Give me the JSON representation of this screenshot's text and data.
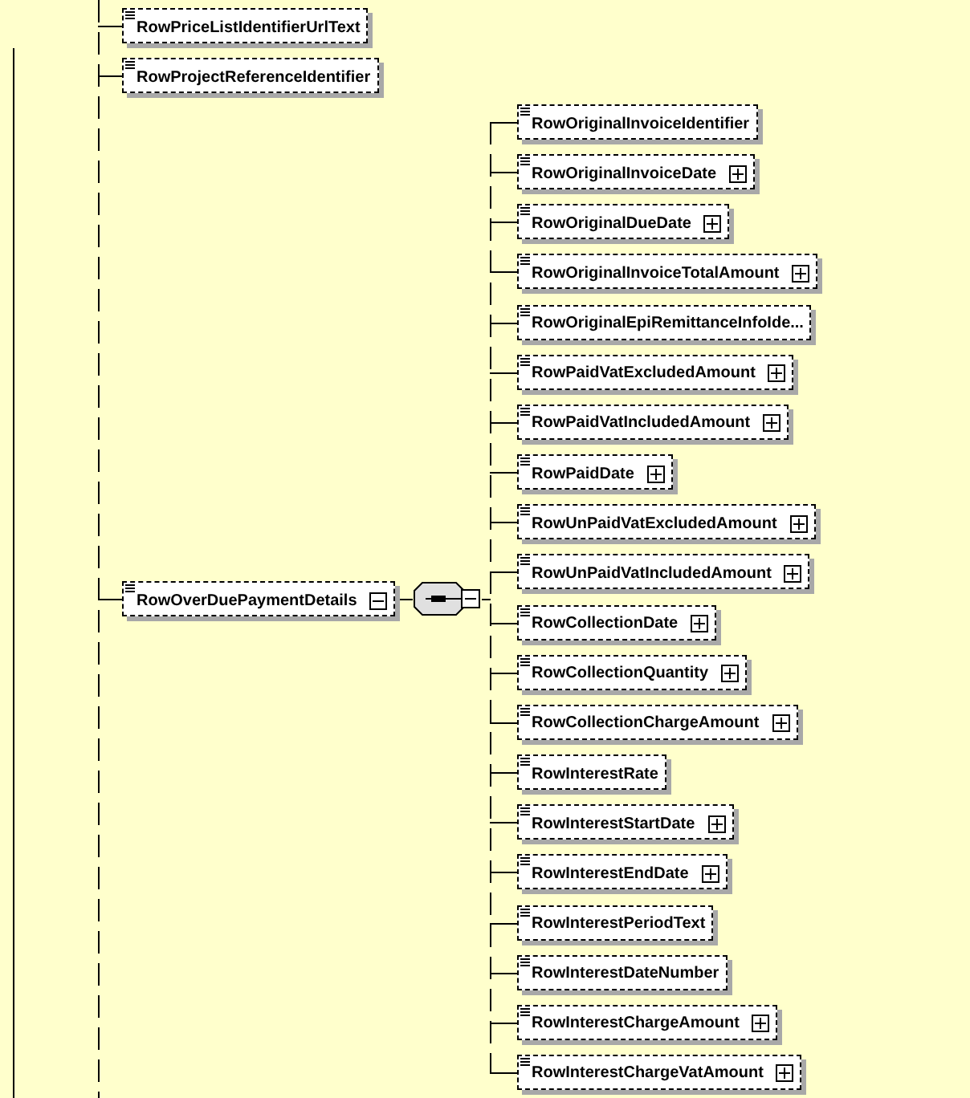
{
  "top_elements": [
    {
      "label": "RowPriceListIdentifierUrlText",
      "optional": true,
      "expandable": false
    },
    {
      "label": "RowProjectReferenceIdentifier",
      "optional": true,
      "expandable": false
    }
  ],
  "element": {
    "label": "RowOverDuePaymentDetails",
    "optional": true,
    "expanded": true
  },
  "sequence": {
    "expanded": true
  },
  "children": [
    {
      "label": "RowOriginalInvoiceIdentifier",
      "optional": true,
      "expandable": false
    },
    {
      "label": "RowOriginalInvoiceDate",
      "optional": true,
      "expandable": true
    },
    {
      "label": "RowOriginalDueDate",
      "optional": true,
      "expandable": true
    },
    {
      "label": "RowOriginalInvoiceTotalAmount",
      "optional": true,
      "expandable": true
    },
    {
      "label": "RowOriginalEpiRemittanceInfoIde...",
      "optional": true,
      "expandable": false
    },
    {
      "label": "RowPaidVatExcludedAmount",
      "optional": true,
      "expandable": true
    },
    {
      "label": "RowPaidVatIncludedAmount",
      "optional": true,
      "expandable": true
    },
    {
      "label": "RowPaidDate",
      "optional": true,
      "expandable": true
    },
    {
      "label": "RowUnPaidVatExcludedAmount",
      "optional": true,
      "expandable": true
    },
    {
      "label": "RowUnPaidVatIncludedAmount",
      "optional": true,
      "expandable": true
    },
    {
      "label": "RowCollectionDate",
      "optional": true,
      "expandable": true
    },
    {
      "label": "RowCollectionQuantity",
      "optional": true,
      "expandable": true
    },
    {
      "label": "RowCollectionChargeAmount",
      "optional": true,
      "expandable": true
    },
    {
      "label": "RowInterestRate",
      "optional": true,
      "expandable": false
    },
    {
      "label": "RowInterestStartDate",
      "optional": true,
      "expandable": true
    },
    {
      "label": "RowInterestEndDate",
      "optional": true,
      "expandable": true
    },
    {
      "label": "RowInterestPeriodText",
      "optional": true,
      "expandable": false
    },
    {
      "label": "RowInterestDateNumber",
      "optional": true,
      "expandable": false
    },
    {
      "label": "RowInterestChargeAmount",
      "optional": true,
      "expandable": true
    },
    {
      "label": "RowInterestChargeVatAmount",
      "optional": true,
      "expandable": true
    }
  ]
}
